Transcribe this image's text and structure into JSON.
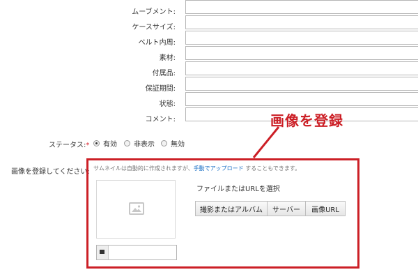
{
  "fields": [
    {
      "label": "ムーブメント:"
    },
    {
      "label": "ケースサイズ:"
    },
    {
      "label": "ベルト内周:"
    },
    {
      "label": "素材:"
    },
    {
      "label": "付属品:"
    },
    {
      "label": "保証期間:"
    },
    {
      "label": "状態:"
    },
    {
      "label": "コメント:"
    }
  ],
  "status": {
    "label": "ステータス:",
    "required_mark": "*",
    "options": [
      "有効",
      "非表示",
      "無効"
    ],
    "selected": "有効"
  },
  "image": {
    "label": "画像を登録してください:",
    "hint_before": "サムネイルは自動的に作成されますが、",
    "hint_link": "手動でアップロード",
    "hint_after": " することもできます。",
    "file_title": "ファイルまたはURLを選択",
    "buttons": [
      "撮影またはアルバム",
      "サーバー",
      "画像URL"
    ]
  },
  "annotation": "画像を登録",
  "colors": {
    "annotation": "#cc1f26",
    "link": "#1a6fc4"
  }
}
